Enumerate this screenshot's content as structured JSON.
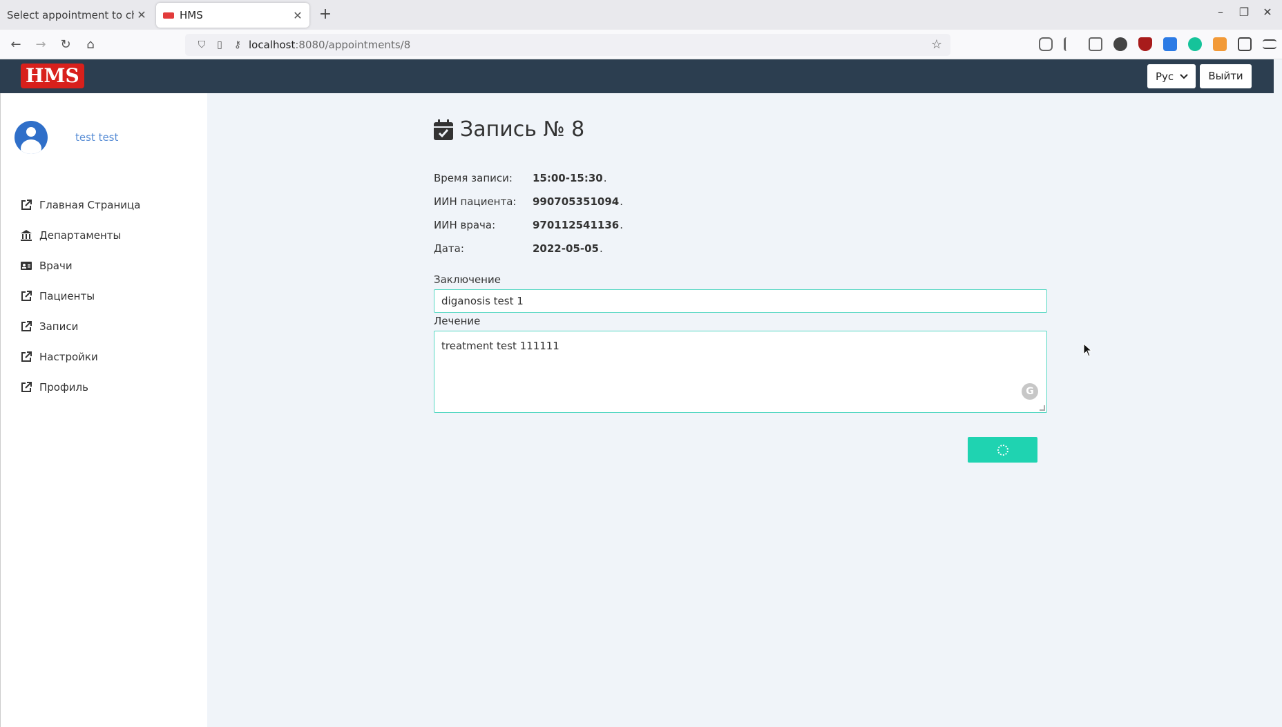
{
  "browser": {
    "tabs": [
      {
        "title": "Select appointment to chang",
        "active": false
      },
      {
        "title": "HMS",
        "active": true
      }
    ],
    "url_host": "localhost",
    "url_path": ":8080/appointments/8"
  },
  "header": {
    "logo": "HMS",
    "language": "Рус",
    "logout_label": "Выйти"
  },
  "sidebar": {
    "user_name": "test test",
    "items": [
      {
        "label": "Главная Страница",
        "icon": "external-link-icon"
      },
      {
        "label": "Департаменты",
        "icon": "bank-icon"
      },
      {
        "label": "Врачи",
        "icon": "id-card-icon"
      },
      {
        "label": "Пациенты",
        "icon": "external-link-icon"
      },
      {
        "label": "Записи",
        "icon": "external-link-icon"
      },
      {
        "label": "Настройки",
        "icon": "external-link-icon"
      },
      {
        "label": "Профиль",
        "icon": "external-link-icon"
      }
    ]
  },
  "appointment": {
    "title": "Запись № 8",
    "rows": [
      {
        "label": "Время записи:",
        "value": "15:00-15:30"
      },
      {
        "label": "ИИН пациента:",
        "value": "990705351094"
      },
      {
        "label": "ИИН врача:",
        "value": "970112541136"
      },
      {
        "label": "Дата:",
        "value": "2022-05-05"
      }
    ],
    "conclusion_label": "Заключение",
    "conclusion_value": "diganosis test 1",
    "treatment_label": "Лечение",
    "treatment_value": "treatment test 111111"
  },
  "colors": {
    "header_bg": "#2c3e50",
    "accent": "#1fd3b1",
    "logo_bg": "#d8201c"
  }
}
